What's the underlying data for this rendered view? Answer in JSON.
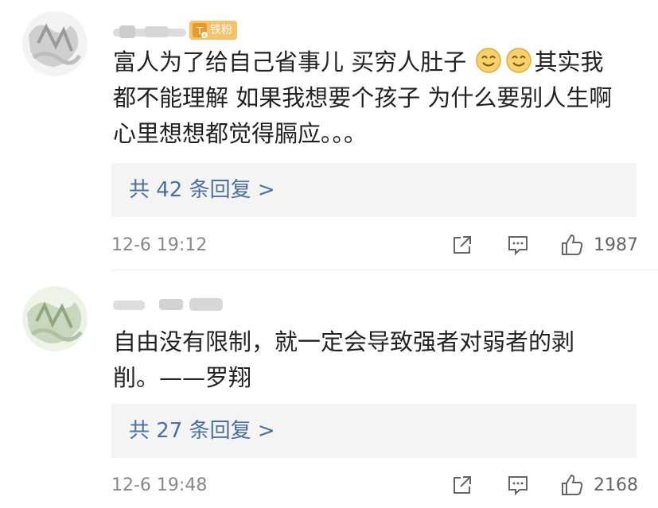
{
  "comments": [
    {
      "badge": "铁粉",
      "text": [
        "富人为了给自己省事儿 买穷人肚子",
        "其实我",
        "都不能理解 如果我想要个孩子 为什么要别人生啊",
        "心里想想都觉得膈应。。。"
      ],
      "replies": "共 42 条回复 >",
      "time": "12-6 19:12",
      "likes": "1987"
    },
    {
      "text": [
        "自由没有限制，就一定会导致强者对弱者的剥",
        "削。——罗翔"
      ],
      "replies": "共 27 条回复 >",
      "time": "12-6 19:48",
      "likes": "2168"
    }
  ],
  "icons": {
    "share": "share-icon",
    "comment": "comment-icon",
    "like": "thumbs-up-icon",
    "emoji": "smiley-face-emoji",
    "fan_badge": "iron-fan-badge-icon"
  },
  "colors": {
    "reply_link": "#4a6fa5",
    "badge": "#f6c26a",
    "reply_bg": "#f4f4f4"
  }
}
